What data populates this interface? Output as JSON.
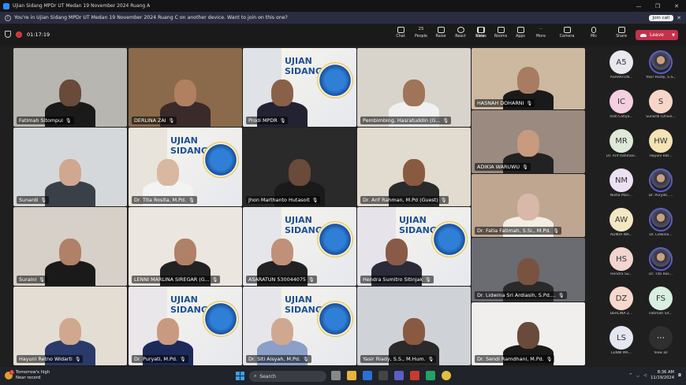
{
  "window": {
    "title": "Ujian Sidang MPDr UT Medan 19 November 2024 Ruang A",
    "controls": [
      "—",
      "❐",
      "✕"
    ]
  },
  "notice": {
    "text": "You're in Ujian Sidang MPDr UT Medan 19 November 2024 Ruang C on another device. Want to join on this one?",
    "join_label": "Join call",
    "close": "✕"
  },
  "toolbar": {
    "timer": "01:17:19",
    "people_count": "25",
    "buttons": [
      {
        "label": "Chat",
        "icon": "chat-icon",
        "glyph": "💬"
      },
      {
        "label": "People",
        "icon": "people-icon",
        "glyph": "👥"
      },
      {
        "label": "Raise",
        "icon": "raise-hand-icon",
        "glyph": "✋"
      },
      {
        "label": "React",
        "icon": "react-icon",
        "glyph": "☺"
      },
      {
        "label": "Notes",
        "icon": "notes-icon",
        "glyph": "▤"
      },
      {
        "label": "View",
        "icon": "view-icon",
        "glyph": "▦"
      },
      {
        "label": "Rooms",
        "icon": "rooms-icon",
        "glyph": "▭"
      },
      {
        "label": "Apps",
        "icon": "apps-icon",
        "glyph": "⊞"
      },
      {
        "label": "More",
        "icon": "more-icon",
        "glyph": "⋯"
      },
      {
        "label": "Camera",
        "icon": "camera-icon",
        "glyph": "▶"
      },
      {
        "label": "Mic",
        "icon": "mic-icon",
        "glyph": "🎤"
      },
      {
        "label": "Share",
        "icon": "share-icon",
        "glyph": "⇪"
      }
    ],
    "leave_label": "Leave"
  },
  "slide": {
    "title_line1": "UJIAN",
    "title_line2": "SIDANG"
  },
  "tiles": [
    {
      "name": "Fatimah Sitompul"
    },
    {
      "name": "DERLINA ZAI"
    },
    {
      "name": "Prodi MPDR"
    },
    {
      "name": "Pembimbing, Hasratuddin (G..."
    },
    {
      "name": "HASNAH DOHARNI"
    },
    {
      "name": "Sunardi"
    },
    {
      "name": "Dr. Tita Rosita, M.Pd."
    },
    {
      "name": "Jhon Marthanto Hutasoit"
    },
    {
      "name": "Dr. Arif Rahman, M.Pd (Guest)"
    },
    {
      "name": "ADIKIA WARUWU"
    },
    {
      "name": "Dr. Fatia Fatimah, S.Si., M.Pd."
    },
    {
      "name": "Suraini"
    },
    {
      "name": "LENNI MARLINA SIREGAR (G..."
    },
    {
      "name": "ASARATUN 530044075"
    },
    {
      "name": "Hendra Sumitro Sitinjak"
    },
    {
      "name": "Dr. Lidwina Sri Ardiasih, S.Pd...."
    },
    {
      "name": "Hayuni Retno Widarti"
    },
    {
      "name": "Dr. Puryati, M.Pd."
    },
    {
      "name": "Dr. Siti Aisyah, M.Pd."
    },
    {
      "name": "Yasir Riady, S.S., M.Hum."
    },
    {
      "name": "Dr. Sendi Ramdhani, M.Pd."
    }
  ],
  "roster": [
    {
      "initials": "A5",
      "label": "ASARATUN...",
      "color": "#e8e8ee"
    },
    {
      "initials": "",
      "label": "Yasir Riady, S.S.,...",
      "color": ""
    },
    {
      "initials": "IC",
      "label": "Isah Cahya...",
      "color": "#f3cfe0"
    },
    {
      "initials": "S",
      "label": "Sunardi (Unive...",
      "color": "#f6d6c8"
    },
    {
      "initials": "MR",
      "label": "Dr. Arif Rahman...",
      "color": "#dfe9d8"
    },
    {
      "initials": "HW",
      "label": "Hayuni Ret...",
      "color": "#f4e3b5"
    },
    {
      "initials": "NM",
      "label": "Nisha Mari...",
      "color": "#ece0f3"
    },
    {
      "initials": "",
      "label": "Dr. Puryati, ...",
      "color": ""
    },
    {
      "initials": "AW",
      "label": "ADIKIA WA...",
      "color": "#f3e7c3"
    },
    {
      "initials": "",
      "label": "Dr. Lidwina...",
      "color": ""
    },
    {
      "initials": "HS",
      "label": "Hendra Su...",
      "color": "#f3d4cf"
    },
    {
      "initials": "",
      "label": "Dr. Tita Ros...",
      "color": ""
    },
    {
      "initials": "DZ",
      "label": "DERLINA Z...",
      "color": "#f6d8cc"
    },
    {
      "initials": "FS",
      "label": "Fatimah Sit...",
      "color": "#d8eee0"
    },
    {
      "initials": "LS",
      "label": "LENNI MA...",
      "color": "#e4e6f2"
    },
    {
      "initials": "⋯",
      "label": "View all",
      "color": "#2f2f2f"
    }
  ],
  "taskbar": {
    "weather_line1": "Tomorrow's high",
    "weather_line2": "Near record",
    "weather_badge": "1",
    "search_placeholder": "Search",
    "time": "8:36 AM",
    "date": "11/19/2024"
  }
}
